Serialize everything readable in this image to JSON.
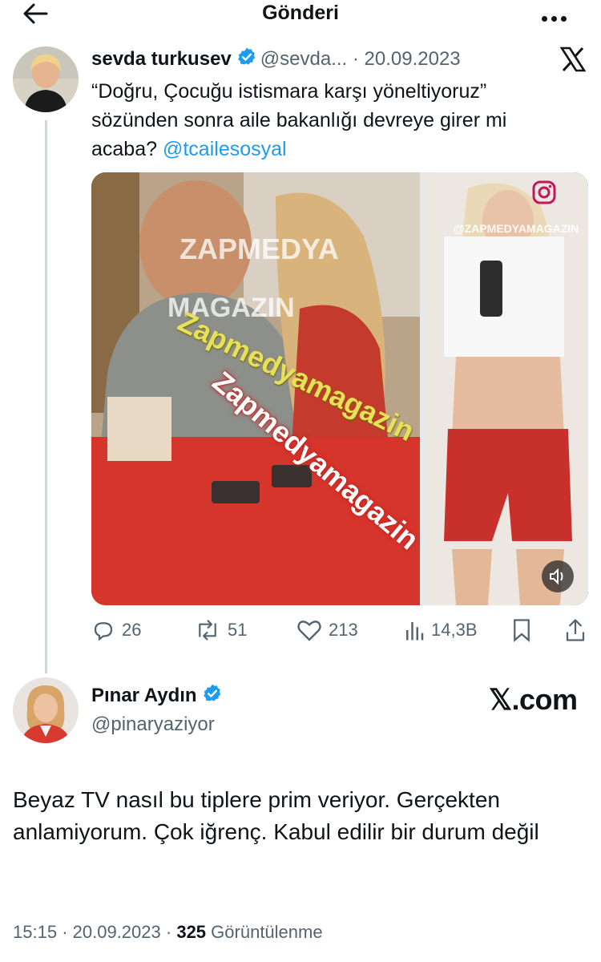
{
  "header": {
    "title": "Gönderi"
  },
  "quoted": {
    "name": "sevda turkusev",
    "handle": "@sevda...",
    "separator": "·",
    "date": "20.09.2023",
    "text": "“Doğru, Çocuğu istismara karşı yöneltiyoruz” sözünden sonra aile bakanlığı devreye girer mi acaba?",
    "mention": "@tcailesosyal",
    "media": {
      "watermark_left_1": "ZAPMEDYA",
      "watermark_left_2": "MAGAZIN",
      "watermark_diagonal_1": "Zapmedyamagazin",
      "watermark_diagonal_2": "Zapmedyamagazin",
      "watermark_right": "@ZAPMEDYAMAGAZIN"
    },
    "stats": {
      "replies": "26",
      "reposts": "51",
      "likes": "213",
      "views": "14,3B"
    }
  },
  "reply": {
    "name": "Pınar Aydın",
    "handle": "@pinaryaziyor",
    "brand": "𝕏.com",
    "text": "Beyaz TV nasıl bu tiplere prim veriyor. Gerçekten anlamiyorum. Çok iğrenç. Kabul edilir bir durum değil",
    "time": "15:15",
    "date": "20.09.2023",
    "views_count": "325",
    "views_label": "Görüntülenme"
  },
  "colors": {
    "accent": "#1d9bf0",
    "verified": "#1d9bf0",
    "muted": "#536471",
    "text": "#0f1419"
  }
}
